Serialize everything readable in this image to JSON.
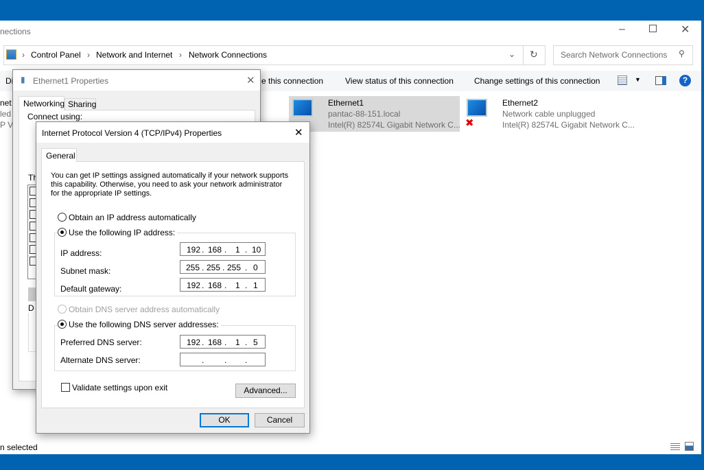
{
  "explorer": {
    "title": "nections",
    "breadcrumb": [
      "Control Panel",
      "Network and Internet",
      "Network Connections"
    ],
    "search_placeholder": "Search Network Connections",
    "toolbar": {
      "clipped_left": "Di",
      "rename": "e this connection",
      "view_status": "View status of this connection",
      "change_settings": "Change settings of this connection"
    },
    "left_clipped": [
      "net",
      "led",
      "P V"
    ],
    "connections": [
      {
        "name": "Ethernet1",
        "status": "pantac-88-151.local",
        "adapter": "Intel(R) 82574L Gigabit Network C...",
        "selected": true
      },
      {
        "name": "Ethernet2",
        "status": "Network cable unplugged",
        "adapter": "Intel(R) 82574L Gigabit Network C...",
        "disconnected": true
      }
    ],
    "status_bar": "n selected"
  },
  "eth_props": {
    "title": "Ethernet1 Properties",
    "tabs": [
      "Networking",
      "Sharing"
    ],
    "connect_using": "Connect using:",
    "this_conn": "Th",
    "group_clip": "D"
  },
  "ipv4": {
    "title": "Internet Protocol Version 4 (TCP/IPv4) Properties",
    "tab": "General",
    "intro": "You can get IP settings assigned automatically if your network supports this capability. Otherwise, you need to ask your network administrator for the appropriate IP settings.",
    "obtain_ip": "Obtain an IP address automatically",
    "use_ip": "Use the following IP address:",
    "ip_label": "IP address:",
    "ip": [
      "192",
      "168",
      "1",
      "10"
    ],
    "mask_label": "Subnet mask:",
    "mask": [
      "255",
      "255",
      "255",
      "0"
    ],
    "gw_label": "Default gateway:",
    "gw": [
      "192",
      "168",
      "1",
      "1"
    ],
    "obtain_dns": "Obtain DNS server address automatically",
    "use_dns": "Use the following DNS server addresses:",
    "pref_label": "Preferred DNS server:",
    "pref": [
      "192",
      "168",
      "1",
      "5"
    ],
    "alt_label": "Alternate DNS server:",
    "alt": [
      "",
      "",
      "",
      ""
    ],
    "validate": "Validate settings upon exit",
    "advanced": "Advanced...",
    "ok": "OK",
    "cancel": "Cancel"
  },
  "colors": {
    "desktop": "#0063b1",
    "accent": "#0078d7"
  }
}
